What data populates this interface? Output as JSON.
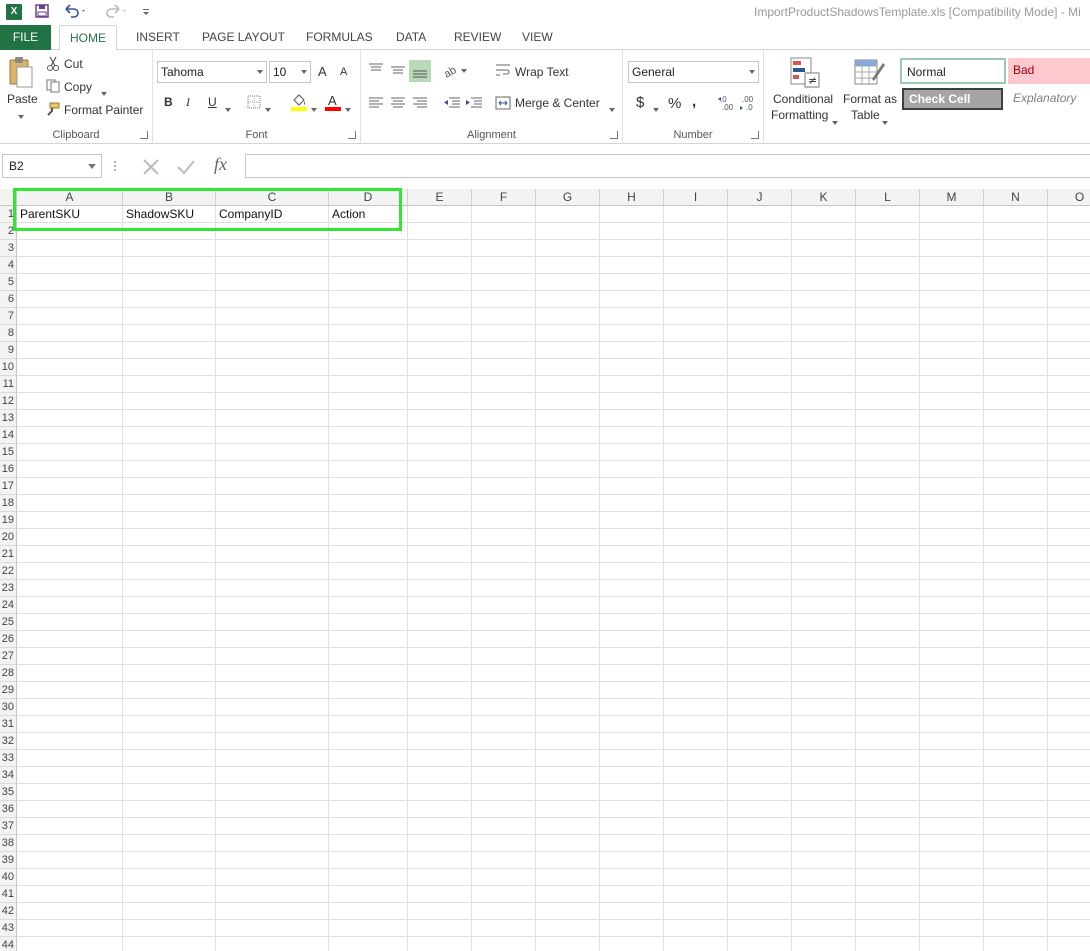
{
  "titlebar": {
    "logo": "X",
    "title": "ImportProductShadowsTemplate.xls  [Compatibility Mode] - Mi",
    "qat_icons": [
      "save-icon",
      "undo-icon",
      "redo-icon",
      "customize-qat-icon"
    ]
  },
  "tabs": [
    "FILE",
    "HOME",
    "INSERT",
    "PAGE LAYOUT",
    "FORMULAS",
    "DATA",
    "REVIEW",
    "VIEW"
  ],
  "clipboard": {
    "paste": "Paste",
    "cut": "Cut",
    "copy": "Copy",
    "format_painter": "Format Painter",
    "label": "Clipboard"
  },
  "font": {
    "name": "Tahoma",
    "size": "10",
    "grow": "A",
    "shrink": "A",
    "bold": "B",
    "italic": "I",
    "underline": "U",
    "fill_color": "#ffff00",
    "font_color": "#ff0000",
    "label": "Font"
  },
  "alignment": {
    "wrap_text": "Wrap Text",
    "merge_center": "Merge & Center",
    "label": "Alignment"
  },
  "number": {
    "format": "General",
    "currency": "$",
    "percent": "%",
    "comma": ",",
    "label": "Number"
  },
  "styles": {
    "conditional_1": "Conditional",
    "conditional_2": "Formatting",
    "format_table_1": "Format as",
    "format_table_2": "Table",
    "normal": "Normal",
    "bad": "Bad",
    "check_cell": "Check Cell",
    "explanatory": "Explanatory"
  },
  "formula_bar": {
    "name_box": "B2",
    "fx": "fx",
    "value": ""
  },
  "sheet": {
    "columns": [
      "A",
      "B",
      "C",
      "D",
      "E",
      "F",
      "G",
      "H",
      "I",
      "J",
      "K",
      "L",
      "M",
      "N",
      "O"
    ],
    "row_count": 44,
    "row1": [
      "ParentSKU",
      "ShadowSKU",
      "CompanyID",
      "Action"
    ]
  },
  "colors": {
    "accent": "#217346",
    "highlight": "#33e633",
    "bad_fill": "#ffc7ce",
    "bad_text": "#9c0006",
    "check_fill": "#a5a5a5"
  }
}
